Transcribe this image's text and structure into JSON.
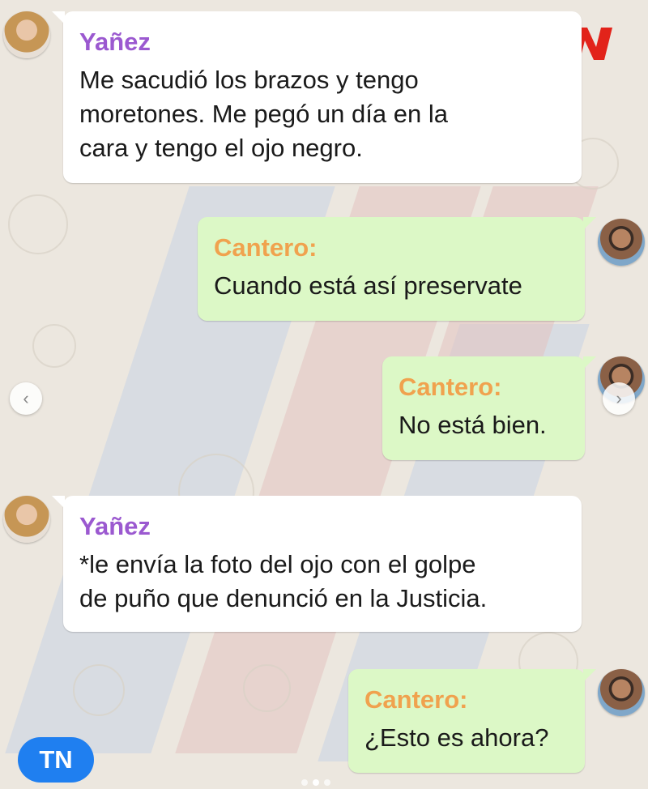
{
  "brand": {
    "logo_text": "TN",
    "badge_label": "TN",
    "blue": "#1f7ff0",
    "red": "#e2231a"
  },
  "colors": {
    "incoming_bubble": "#ffffff",
    "outgoing_bubble": "#dcf8c6",
    "yanez_name": "#9b59d0",
    "cantero_name": "#f0a24e"
  },
  "messages": [
    {
      "sender": "Yañez",
      "text": "Me sacudió los brazos y tengo\nmoretones. Me pegó un día en la\ncara y tengo el ojo negro."
    },
    {
      "sender": "Cantero:",
      "text": "Cuando está así preservate"
    },
    {
      "sender": "Cantero:",
      "text": "No está bien."
    },
    {
      "sender": "Yañez",
      "text": "*le envía la foto del ojo con el golpe\nde puño que denunció en la Justicia."
    },
    {
      "sender": "Cantero:",
      "text": "¿Esto es ahora?"
    }
  ],
  "carousel": {
    "prev_icon": "chevron-left-icon",
    "next_icon": "chevron-right-icon",
    "pages": 3,
    "active_page": 2
  }
}
